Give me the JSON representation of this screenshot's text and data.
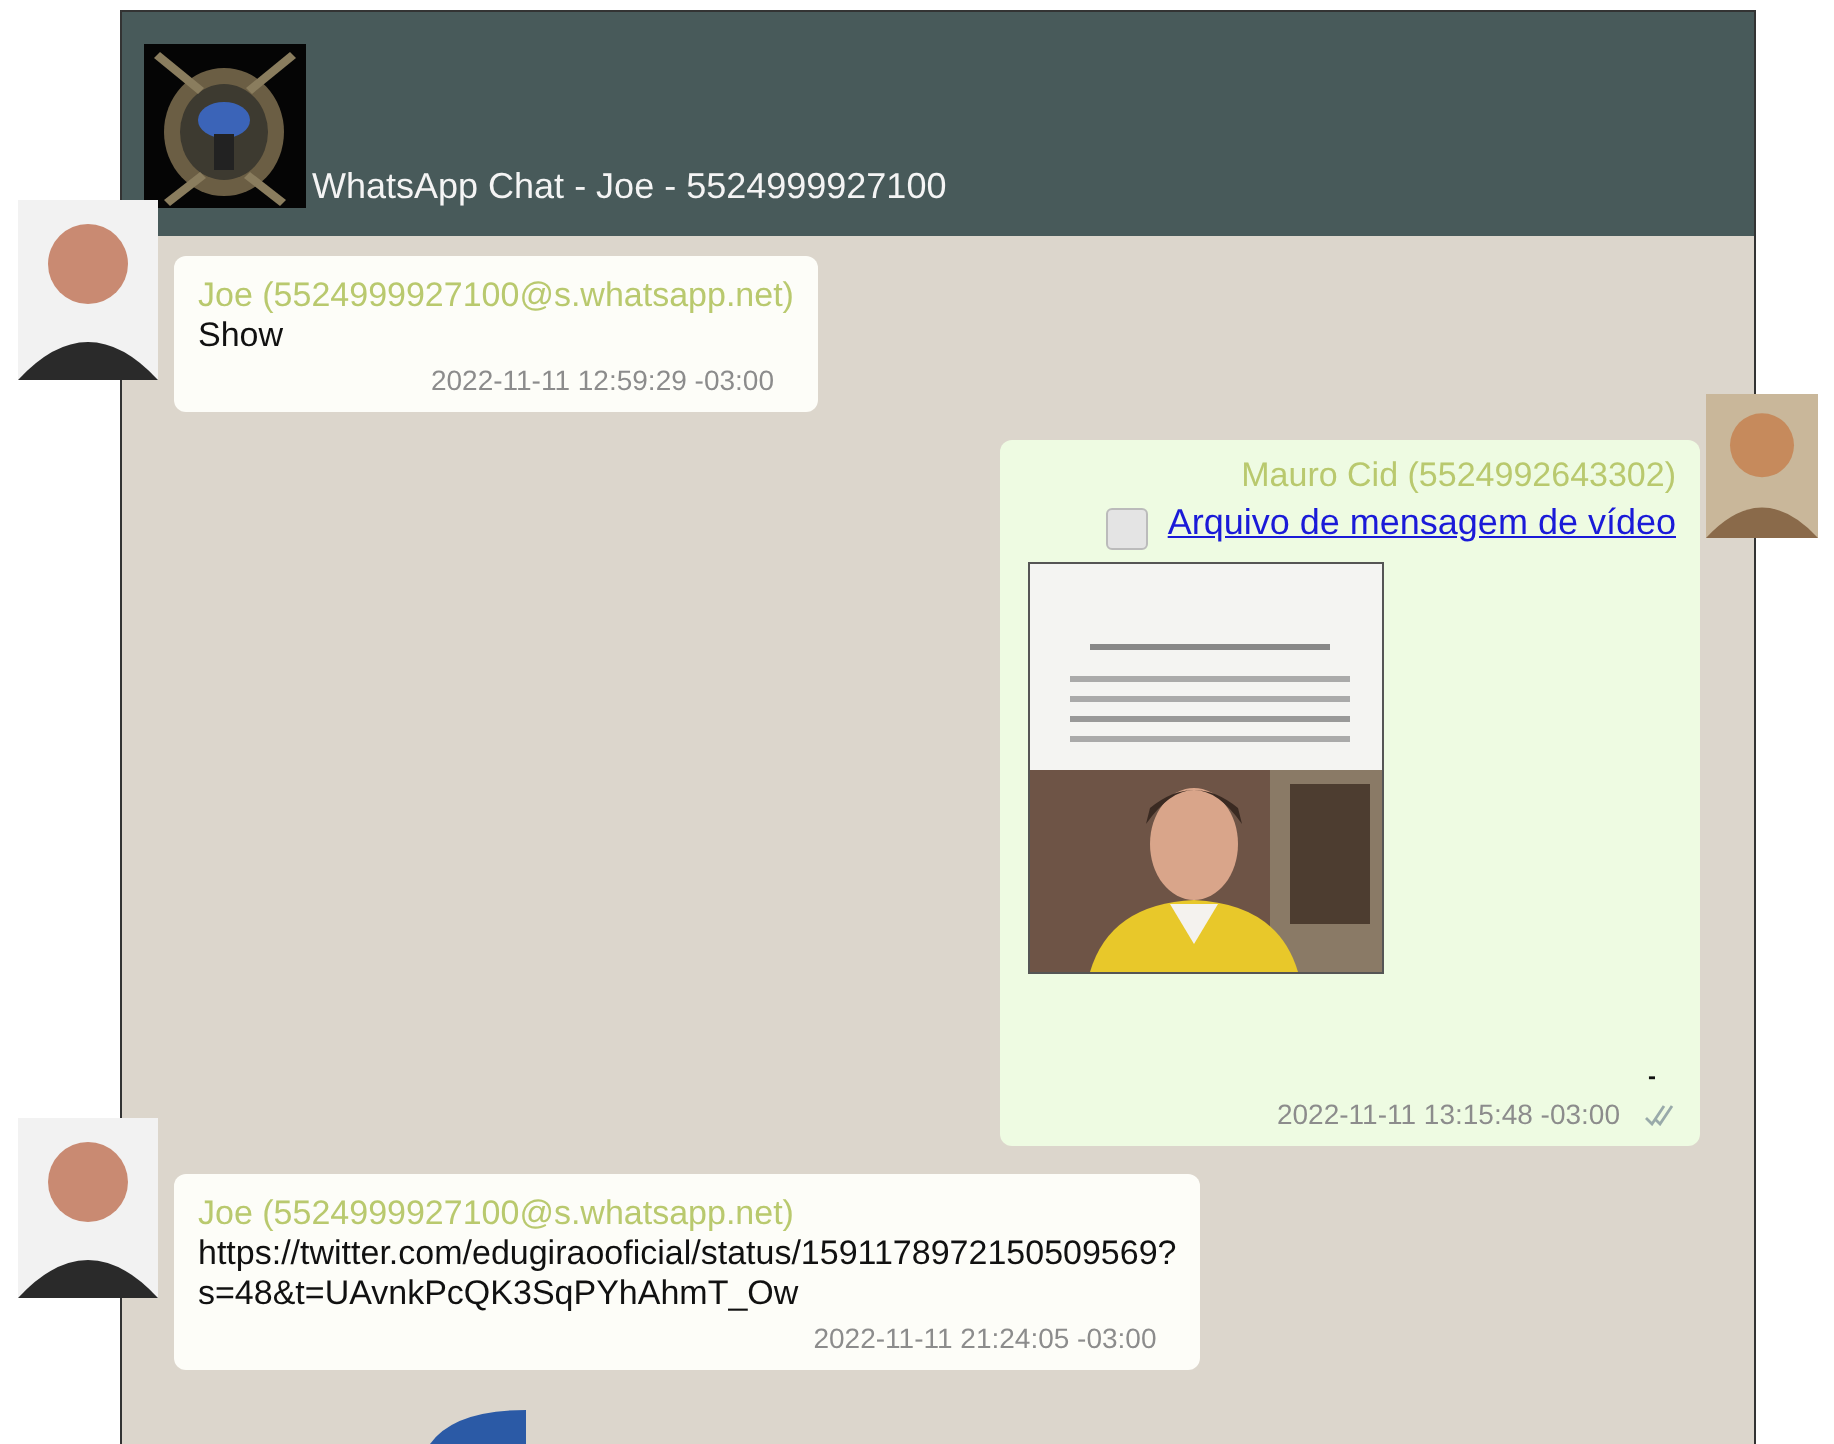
{
  "header": {
    "title": "WhatsApp Chat - Joe - 5524999927100"
  },
  "messages": [
    {
      "kind": "text",
      "outgoing": false,
      "sender": "Joe (5524999927100@s.whatsapp.net)",
      "text": "Show",
      "time": "2022-11-11 12:59:29 -03:00"
    },
    {
      "kind": "video",
      "outgoing": true,
      "sender": "Mauro Cid (5524992643302)",
      "link": "Arquivo de mensagem de vídeo",
      "checked": false,
      "caption": "-",
      "time": "2022-11-11 13:15:48 -03:00",
      "read": true
    },
    {
      "kind": "text",
      "outgoing": false,
      "sender": "Joe (5524999927100@s.whatsapp.net)",
      "text": "https://twitter.com/edugiraooficial/status/1591178972150509569?\ns=48&t=UAvnkPcQK3SqPYhAhmT_Ow",
      "time": "2022-11-11 21:24:05 -03:00"
    }
  ]
}
